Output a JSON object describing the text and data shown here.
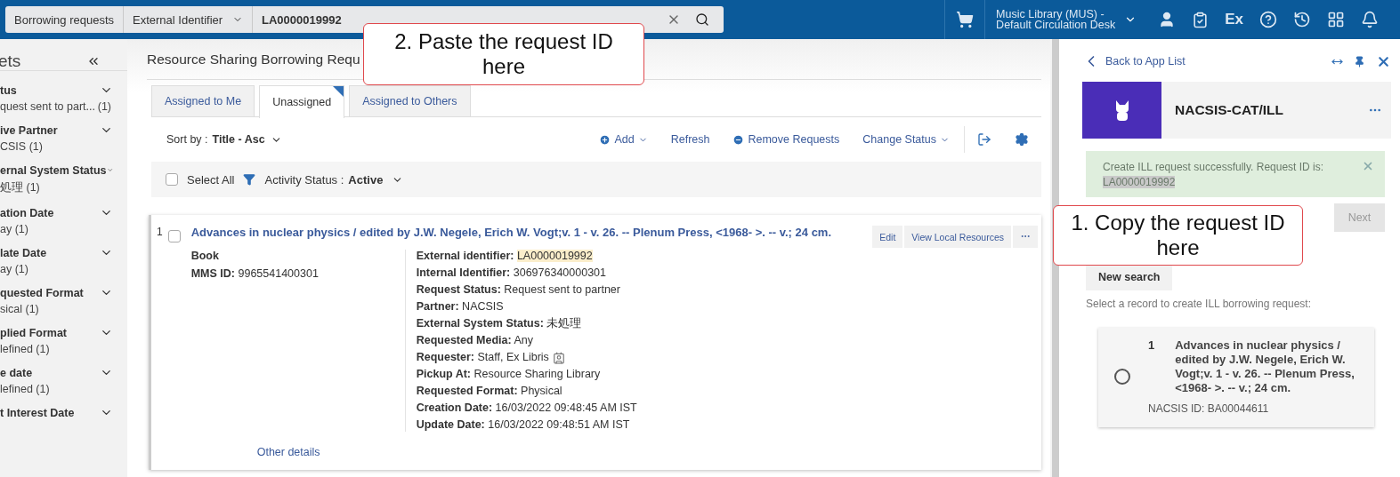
{
  "top_bar": {
    "search_scope": "Borrowing requests",
    "search_field": "External Identifier",
    "search_value": "LA0000019992",
    "location": [
      "Music Library (MUS) -",
      "Default Circulation Desk"
    ],
    "ex_label": "Ex"
  },
  "facets": {
    "title": "ets",
    "groups": [
      {
        "label": "tus",
        "value": "quest sent to part...",
        "count": "(1)"
      },
      {
        "label": "ive Partner",
        "value": "CSIS (1)"
      },
      {
        "label": "ernal System Status",
        "value": "処理 (1)"
      },
      {
        "label": "ation Date",
        "value": "ay (1)"
      },
      {
        "label": "late Date",
        "value": "ay (1)"
      },
      {
        "label": "quested Format",
        "value": "sical (1)"
      },
      {
        "label": "plied Format",
        "value": "lefined (1)"
      },
      {
        "label": "e date",
        "value": "lefined (1)"
      },
      {
        "label": "t Interest Date"
      }
    ]
  },
  "page_title": "Resource Sharing Borrowing Requ",
  "tabs": [
    {
      "label": "Assigned to Me",
      "selected": false
    },
    {
      "label": "Unassigned",
      "selected": true
    },
    {
      "label": "Assigned to Others",
      "selected": false
    }
  ],
  "toolbar": {
    "sort_label": "Sort by :",
    "sort_value": "Title - Asc",
    "actions": [
      {
        "label": "Add",
        "kind": "add"
      },
      {
        "label": "Refresh",
        "kind": "plain"
      },
      {
        "label": "Remove Requests",
        "kind": "remove"
      },
      {
        "label": "Change Status",
        "kind": "menu"
      }
    ]
  },
  "filter_bar": {
    "select_all": "Select All",
    "checked": false,
    "activity_label": "Activity Status :",
    "activity_value": "Active"
  },
  "results": [
    {
      "index": "1",
      "checked": false,
      "title": "Advances in nuclear physics / edited by J.W. Negele, Erich W. Vogt;v. 1 - v. 26. -- Plenum Press, <1968- >. -- v.; 24 cm.",
      "type": "Book",
      "mms_label": "MMS ID:",
      "mms_value": "9965541400301",
      "fields": [
        {
          "label": "External identifier:",
          "value": "LA0000019992",
          "highlighted": true
        },
        {
          "label": "Internal Identifier:",
          "value": "306976340000301",
          "highlighted": false
        },
        {
          "label": "Request Status:",
          "value": "Request sent to partner",
          "highlighted": false
        },
        {
          "label": "Partner:",
          "value": "NACSIS",
          "highlighted": false
        },
        {
          "label": "External System Status:",
          "value": "未処理",
          "highlighted": false
        },
        {
          "label": "Requested Media:",
          "value": "Any",
          "highlighted": false
        },
        {
          "label": "Requester:",
          "value": "Staff, Ex Libris",
          "highlighted": false,
          "kind": "person"
        },
        {
          "label": "Pickup At:",
          "value": "Resource Sharing Library",
          "highlighted": false
        },
        {
          "label": "Requested Format:",
          "value": "Physical",
          "highlighted": false
        },
        {
          "label": "Creation Date:",
          "value": "16/03/2022 09:48:45 AM IST",
          "highlighted": false
        },
        {
          "label": "Update Date:",
          "value": "16/03/2022 09:48:51 AM IST",
          "highlighted": false
        }
      ],
      "buttons": [
        "Edit",
        "View Local Resources"
      ],
      "more_link": "Other details"
    }
  ],
  "side_panel": {
    "back": "Back to App List",
    "app_name": "NACSIS-CAT/ILL",
    "message": "Create ILL request successfully. Request ID is:",
    "message_id": "LA0000019992",
    "next": "Next",
    "next_disabled": true,
    "new_search": "New search",
    "prompt": "Select a record to create ILL borrowing request:",
    "records": [
      {
        "index": "1",
        "title": "Advances in nuclear physics / edited by J.W. Negele, Erich W. Vogt;v. 1 - v. 26. -- Plenum Press, <1968- >. -- v.; 24 cm.",
        "id": "NACSIS ID: BA00044611",
        "selected": false
      }
    ]
  },
  "callouts": [
    {
      "text": "2. Paste the request ID here"
    },
    {
      "text": "1. Copy the request ID here"
    }
  ]
}
